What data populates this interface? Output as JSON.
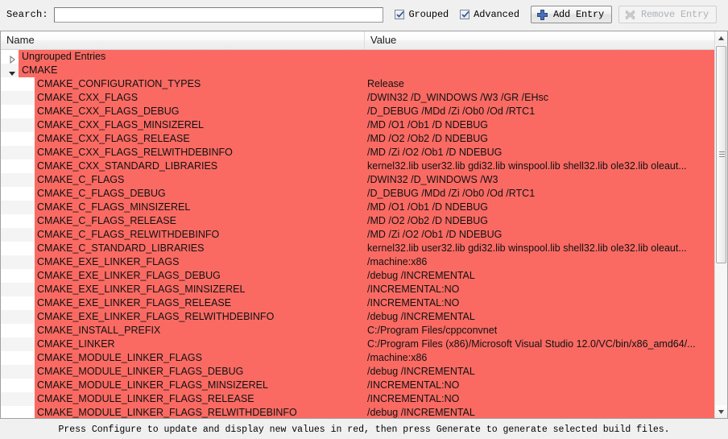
{
  "toolbar": {
    "search_label": "Search:",
    "search_value": "",
    "search_placeholder": "",
    "grouped_label": "Grouped",
    "grouped_checked": true,
    "advanced_label": "Advanced",
    "advanced_checked": true,
    "add_entry_label": "Add Entry",
    "remove_entry_label": "Remove Entry",
    "remove_entry_enabled": false
  },
  "tree": {
    "columns": [
      "Name",
      "Value"
    ],
    "rows": [
      {
        "type": "group",
        "name": "Ungrouped Entries",
        "value": "",
        "expanded": false
      },
      {
        "type": "group",
        "name": "CMAKE",
        "value": "",
        "expanded": true
      },
      {
        "type": "child",
        "name": "CMAKE_CONFIGURATION_TYPES",
        "value": "Release"
      },
      {
        "type": "child",
        "name": "CMAKE_CXX_FLAGS",
        "value": " /DWIN32 /D_WINDOWS /W3 /GR /EHsc"
      },
      {
        "type": "child",
        "name": "CMAKE_CXX_FLAGS_DEBUG",
        "value": "/D_DEBUG /MDd /Zi /Ob0 /Od /RTC1"
      },
      {
        "type": "child",
        "name": "CMAKE_CXX_FLAGS_MINSIZEREL",
        "value": "/MD /O1 /Ob1 /D NDEBUG"
      },
      {
        "type": "child",
        "name": "CMAKE_CXX_FLAGS_RELEASE",
        "value": "/MD /O2 /Ob2 /D NDEBUG"
      },
      {
        "type": "child",
        "name": "CMAKE_CXX_FLAGS_RELWITHDEBINFO",
        "value": "/MD /Zi /O2 /Ob1 /D NDEBUG"
      },
      {
        "type": "child",
        "name": "CMAKE_CXX_STANDARD_LIBRARIES",
        "value": "kernel32.lib user32.lib gdi32.lib winspool.lib shell32.lib ole32.lib oleaut..."
      },
      {
        "type": "child",
        "name": "CMAKE_C_FLAGS",
        "value": " /DWIN32 /D_WINDOWS /W3"
      },
      {
        "type": "child",
        "name": "CMAKE_C_FLAGS_DEBUG",
        "value": "/D_DEBUG /MDd /Zi /Ob0 /Od /RTC1"
      },
      {
        "type": "child",
        "name": "CMAKE_C_FLAGS_MINSIZEREL",
        "value": "/MD /O1 /Ob1 /D NDEBUG"
      },
      {
        "type": "child",
        "name": "CMAKE_C_FLAGS_RELEASE",
        "value": "/MD /O2 /Ob2 /D NDEBUG"
      },
      {
        "type": "child",
        "name": "CMAKE_C_FLAGS_RELWITHDEBINFO",
        "value": "/MD /Zi /O2 /Ob1 /D NDEBUG"
      },
      {
        "type": "child",
        "name": "CMAKE_C_STANDARD_LIBRARIES",
        "value": "kernel32.lib user32.lib gdi32.lib winspool.lib shell32.lib ole32.lib oleaut..."
      },
      {
        "type": "child",
        "name": "CMAKE_EXE_LINKER_FLAGS",
        "value": "/machine:x86"
      },
      {
        "type": "child",
        "name": "CMAKE_EXE_LINKER_FLAGS_DEBUG",
        "value": "/debug /INCREMENTAL"
      },
      {
        "type": "child",
        "name": "CMAKE_EXE_LINKER_FLAGS_MINSIZEREL",
        "value": "/INCREMENTAL:NO"
      },
      {
        "type": "child",
        "name": "CMAKE_EXE_LINKER_FLAGS_RELEASE",
        "value": "/INCREMENTAL:NO"
      },
      {
        "type": "child",
        "name": "CMAKE_EXE_LINKER_FLAGS_RELWITHDEBINFO",
        "value": "/debug /INCREMENTAL"
      },
      {
        "type": "child",
        "name": "CMAKE_INSTALL_PREFIX",
        "value": "C:/Program Files/cppconvnet"
      },
      {
        "type": "child",
        "name": "CMAKE_LINKER",
        "value": "C:/Program Files (x86)/Microsoft Visual Studio 12.0/VC/bin/x86_amd64/..."
      },
      {
        "type": "child",
        "name": "CMAKE_MODULE_LINKER_FLAGS",
        "value": "/machine:x86"
      },
      {
        "type": "child",
        "name": "CMAKE_MODULE_LINKER_FLAGS_DEBUG",
        "value": "/debug /INCREMENTAL"
      },
      {
        "type": "child",
        "name": "CMAKE_MODULE_LINKER_FLAGS_MINSIZEREL",
        "value": "/INCREMENTAL:NO"
      },
      {
        "type": "child",
        "name": "CMAKE_MODULE_LINKER_FLAGS_RELEASE",
        "value": "/INCREMENTAL:NO"
      },
      {
        "type": "child",
        "name": "CMAKE_MODULE_LINKER_FLAGS_RELWITHDEBINFO",
        "value": "/debug /INCREMENTAL"
      }
    ]
  },
  "scrollbar": {
    "up_arrow": "scroll-up-arrow",
    "down_arrow": "scroll-down-arrow"
  },
  "statusbar": {
    "message": "Press Configure to update and display new values in red, then press Generate to generate selected build files."
  },
  "colors": {
    "modified_row": "#fa6a63",
    "window_bg": "#f0f0f0",
    "tree_bg": "#ffffff",
    "alt_row": "#f4f4f4",
    "add_icon": "#3c63ab"
  }
}
